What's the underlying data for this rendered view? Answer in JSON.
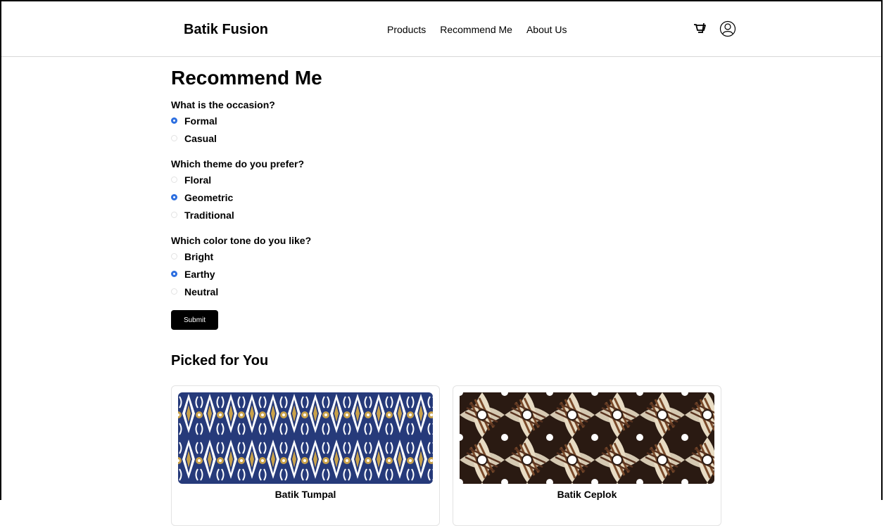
{
  "brand": "Batik Fusion",
  "nav": [
    "Products",
    "Recommend Me",
    "About Us"
  ],
  "icons": {
    "cart": "cart-icon",
    "user": "user-icon"
  },
  "page_title": "Recommend Me",
  "questions": [
    {
      "label": "What is the occasion?",
      "options": [
        "Formal",
        "Casual"
      ],
      "selected": "Formal"
    },
    {
      "label": "Which theme do you prefer?",
      "options": [
        "Floral",
        "Geometric",
        "Traditional"
      ],
      "selected": "Geometric"
    },
    {
      "label": "Which color tone do you like?",
      "options": [
        "Bright",
        "Earthy",
        "Neutral"
      ],
      "selected": "Earthy"
    }
  ],
  "submit_label": "Submit",
  "picked_title": "Picked for You",
  "products": [
    {
      "name": "Batik Tumpal"
    },
    {
      "name": "Batik Ceplok"
    }
  ],
  "colors": {
    "accent": "#2d6fe0",
    "tumpal_bg": "#263a7a",
    "tumpal_gold": "#c9a24a",
    "ceplok_dark": "#2a1a12",
    "ceplok_light": "#e8dcc4"
  }
}
